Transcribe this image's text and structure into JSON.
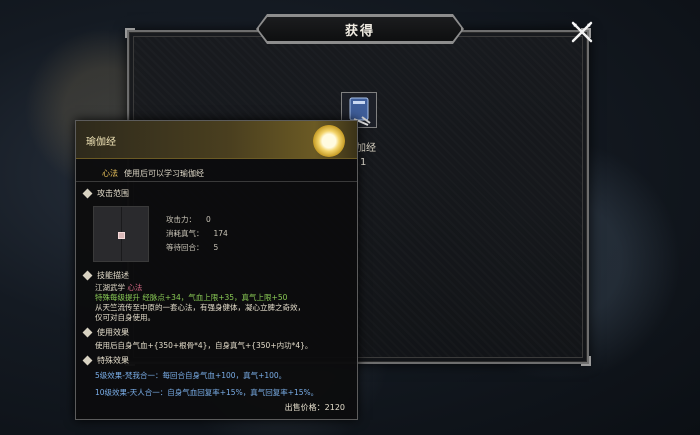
{
  "window": {
    "title": "获得"
  },
  "item": {
    "name": "加经",
    "count": "1"
  },
  "icons": {
    "close": "crossed-swords-close-icon",
    "item": "book-scroll-icon",
    "tooltip": "glowing-lotus-icon",
    "section": "diamond-icon"
  },
  "tooltip": {
    "name": "瑜伽经",
    "type_tag": "心法",
    "type_desc": "使用后可以学习瑜伽经",
    "sections": {
      "attack_range": "攻击范围",
      "skill_desc": "技能描述",
      "use_effect": "使用效果",
      "special_effect": "特殊效果"
    },
    "stats": [
      {
        "label": "攻击力：",
        "value": "0"
      },
      {
        "label": "消耗真气：",
        "value": "174"
      },
      {
        "label": "等待回合：",
        "value": "5"
      }
    ],
    "skill": {
      "school": "江湖武学",
      "school_tag": "心法",
      "bonus": "特殊每级提升 经脉点+34，气血上限+35，真气上限+50",
      "desc1": "从天竺流传至中原的一套心法，有强身健体，凝心立脾之奇效，",
      "desc2": "仅可对自身使用。"
    },
    "use_effect_text": "使用后自身气血+{350+根骨*4}，自身真气+{350+内功*4}。",
    "special": [
      "5级效果-梵我合一：每回合自身气血+100，真气+100。",
      "10级效果-天人合一：自身气血回复率+15%，真气回复率+15%。"
    ],
    "price_label": "出售价格：",
    "price_value": "2120"
  },
  "colors": {
    "gold": "#e0c04a",
    "green": "#8acb55",
    "blue": "#7aaee8",
    "header_gold": "#6b5a24"
  }
}
